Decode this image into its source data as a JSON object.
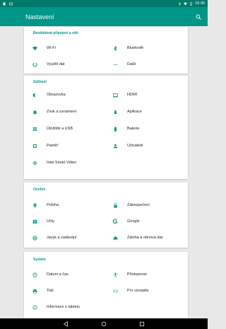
{
  "status": {
    "time": "15:36"
  },
  "appbar": {
    "title": "Nastavení",
    "search_icon": "search-icon"
  },
  "sections": [
    {
      "header": "Bezdrátová připojení a sítě",
      "items": [
        {
          "label": "Wi-Fi",
          "icon": "wifi-icon"
        },
        {
          "label": "Bluetooth",
          "icon": "bluetooth-icon"
        },
        {
          "label": "Využití dat",
          "icon": "data-usage-icon"
        },
        {
          "label": "Další",
          "icon": "more-icon"
        }
      ]
    },
    {
      "header": "Zařízení",
      "items": [
        {
          "label": "Obrazovka",
          "icon": "brightness-icon"
        },
        {
          "label": "HDMI",
          "icon": "hdmi-icon"
        },
        {
          "label": "Zvuk a oznámení",
          "icon": "bell-icon"
        },
        {
          "label": "Aplikace",
          "icon": "android-icon"
        },
        {
          "label": "Úložiště a USB",
          "icon": "storage-icon"
        },
        {
          "label": "Baterie",
          "icon": "battery-icon"
        },
        {
          "label": "Paměť",
          "icon": "memory-icon"
        },
        {
          "label": "Uživatelé",
          "icon": "person-icon"
        },
        {
          "label": "Intel Smart Video",
          "icon": "gear-icon"
        }
      ]
    },
    {
      "header": "Osobní",
      "items": [
        {
          "label": "Poloha",
          "icon": "location-icon"
        },
        {
          "label": "Zabezpečení",
          "icon": "lock-icon"
        },
        {
          "label": "Účty",
          "icon": "account-icon"
        },
        {
          "label": "Google",
          "icon": "google-icon"
        },
        {
          "label": "Jazyk a zadávání",
          "icon": "globe-icon"
        },
        {
          "label": "Záloha a obnova dat",
          "icon": "cloud-icon"
        }
      ]
    },
    {
      "header": "Systém",
      "items": [
        {
          "label": "Datum a čas",
          "icon": "clock-icon"
        },
        {
          "label": "Přístupnost",
          "icon": "accessibility-icon"
        },
        {
          "label": "Tisk",
          "icon": "printer-icon"
        },
        {
          "label": "Pro vývojáře",
          "icon": "code-icon"
        },
        {
          "label": "Informace o tabletu",
          "icon": "info-icon"
        }
      ]
    }
  ],
  "colors": {
    "accent": "#009688",
    "statusbar": "#01796b",
    "background": "#e8e8e8"
  }
}
